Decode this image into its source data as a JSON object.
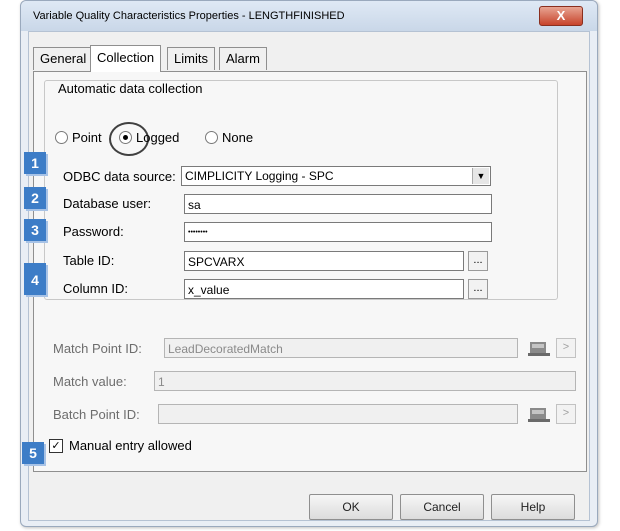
{
  "window": {
    "title": "Variable Quality Characteristics Properties - LENGTHFINISHED",
    "close_label": "X"
  },
  "tabs": [
    {
      "label": "General"
    },
    {
      "label": "Collection"
    },
    {
      "label": "Limits"
    },
    {
      "label": "Alarm"
    }
  ],
  "collection": {
    "group_label": "Automatic data collection",
    "mode_options": [
      {
        "label": "Point",
        "selected": false
      },
      {
        "label": "Logged",
        "selected": true
      },
      {
        "label": "None",
        "selected": false
      }
    ],
    "odbc": {
      "label": "ODBC data source:",
      "value": "CIMPLICITY Logging - SPC"
    },
    "db_user": {
      "label": "Database user:",
      "value": "sa"
    },
    "password": {
      "label": "Password:",
      "value": "••••••••"
    },
    "table_id": {
      "label": "Table ID:",
      "value": "SPCVARX"
    },
    "column_id": {
      "label": "Column ID:",
      "value": "x_value"
    },
    "browse_label": "..."
  },
  "match_point": {
    "label": "Match Point ID:",
    "value": "LeadDecoratedMatch"
  },
  "match_value": {
    "label": "Match value:",
    "value": "1"
  },
  "batch_point": {
    "label": "Batch Point ID:",
    "value": ""
  },
  "manual_entry": {
    "label": "Manual entry allowed",
    "checked": true
  },
  "arrow_label": ">",
  "badges": [
    "1",
    "2",
    "3",
    "4",
    "5"
  ],
  "buttons": {
    "ok": "OK",
    "cancel": "Cancel",
    "help": "Help"
  },
  "colors": {
    "badge": "#3d7dc7",
    "close": "#c7432a"
  }
}
